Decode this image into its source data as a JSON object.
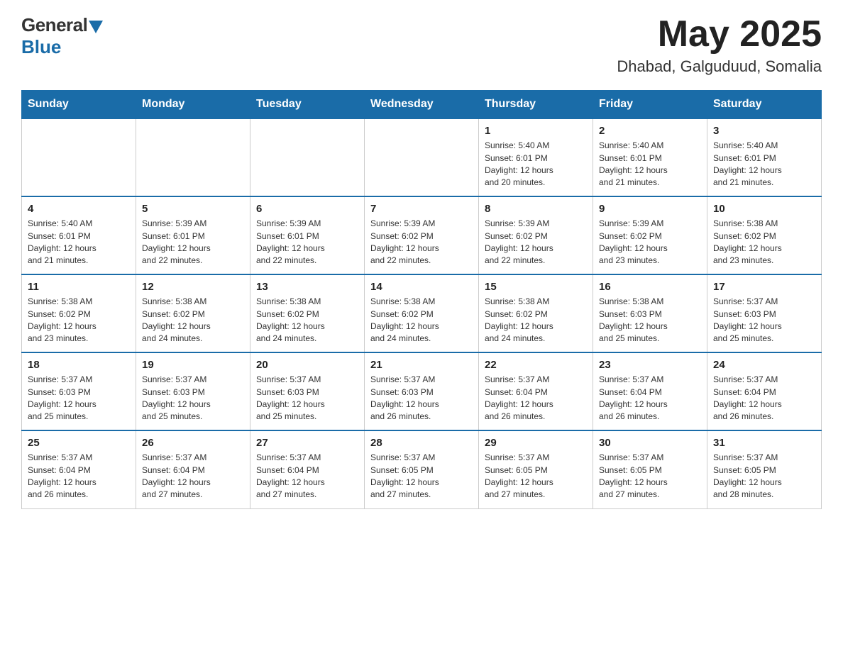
{
  "header": {
    "logo_general": "General",
    "logo_blue": "Blue",
    "month_title": "May 2025",
    "location": "Dhabad, Galguduud, Somalia"
  },
  "weekdays": [
    "Sunday",
    "Monday",
    "Tuesday",
    "Wednesday",
    "Thursday",
    "Friday",
    "Saturday"
  ],
  "weeks": [
    [
      {
        "day": "",
        "info": ""
      },
      {
        "day": "",
        "info": ""
      },
      {
        "day": "",
        "info": ""
      },
      {
        "day": "",
        "info": ""
      },
      {
        "day": "1",
        "info": "Sunrise: 5:40 AM\nSunset: 6:01 PM\nDaylight: 12 hours\nand 20 minutes."
      },
      {
        "day": "2",
        "info": "Sunrise: 5:40 AM\nSunset: 6:01 PM\nDaylight: 12 hours\nand 21 minutes."
      },
      {
        "day": "3",
        "info": "Sunrise: 5:40 AM\nSunset: 6:01 PM\nDaylight: 12 hours\nand 21 minutes."
      }
    ],
    [
      {
        "day": "4",
        "info": "Sunrise: 5:40 AM\nSunset: 6:01 PM\nDaylight: 12 hours\nand 21 minutes."
      },
      {
        "day": "5",
        "info": "Sunrise: 5:39 AM\nSunset: 6:01 PM\nDaylight: 12 hours\nand 22 minutes."
      },
      {
        "day": "6",
        "info": "Sunrise: 5:39 AM\nSunset: 6:01 PM\nDaylight: 12 hours\nand 22 minutes."
      },
      {
        "day": "7",
        "info": "Sunrise: 5:39 AM\nSunset: 6:02 PM\nDaylight: 12 hours\nand 22 minutes."
      },
      {
        "day": "8",
        "info": "Sunrise: 5:39 AM\nSunset: 6:02 PM\nDaylight: 12 hours\nand 22 minutes."
      },
      {
        "day": "9",
        "info": "Sunrise: 5:39 AM\nSunset: 6:02 PM\nDaylight: 12 hours\nand 23 minutes."
      },
      {
        "day": "10",
        "info": "Sunrise: 5:38 AM\nSunset: 6:02 PM\nDaylight: 12 hours\nand 23 minutes."
      }
    ],
    [
      {
        "day": "11",
        "info": "Sunrise: 5:38 AM\nSunset: 6:02 PM\nDaylight: 12 hours\nand 23 minutes."
      },
      {
        "day": "12",
        "info": "Sunrise: 5:38 AM\nSunset: 6:02 PM\nDaylight: 12 hours\nand 24 minutes."
      },
      {
        "day": "13",
        "info": "Sunrise: 5:38 AM\nSunset: 6:02 PM\nDaylight: 12 hours\nand 24 minutes."
      },
      {
        "day": "14",
        "info": "Sunrise: 5:38 AM\nSunset: 6:02 PM\nDaylight: 12 hours\nand 24 minutes."
      },
      {
        "day": "15",
        "info": "Sunrise: 5:38 AM\nSunset: 6:02 PM\nDaylight: 12 hours\nand 24 minutes."
      },
      {
        "day": "16",
        "info": "Sunrise: 5:38 AM\nSunset: 6:03 PM\nDaylight: 12 hours\nand 25 minutes."
      },
      {
        "day": "17",
        "info": "Sunrise: 5:37 AM\nSunset: 6:03 PM\nDaylight: 12 hours\nand 25 minutes."
      }
    ],
    [
      {
        "day": "18",
        "info": "Sunrise: 5:37 AM\nSunset: 6:03 PM\nDaylight: 12 hours\nand 25 minutes."
      },
      {
        "day": "19",
        "info": "Sunrise: 5:37 AM\nSunset: 6:03 PM\nDaylight: 12 hours\nand 25 minutes."
      },
      {
        "day": "20",
        "info": "Sunrise: 5:37 AM\nSunset: 6:03 PM\nDaylight: 12 hours\nand 25 minutes."
      },
      {
        "day": "21",
        "info": "Sunrise: 5:37 AM\nSunset: 6:03 PM\nDaylight: 12 hours\nand 26 minutes."
      },
      {
        "day": "22",
        "info": "Sunrise: 5:37 AM\nSunset: 6:04 PM\nDaylight: 12 hours\nand 26 minutes."
      },
      {
        "day": "23",
        "info": "Sunrise: 5:37 AM\nSunset: 6:04 PM\nDaylight: 12 hours\nand 26 minutes."
      },
      {
        "day": "24",
        "info": "Sunrise: 5:37 AM\nSunset: 6:04 PM\nDaylight: 12 hours\nand 26 minutes."
      }
    ],
    [
      {
        "day": "25",
        "info": "Sunrise: 5:37 AM\nSunset: 6:04 PM\nDaylight: 12 hours\nand 26 minutes."
      },
      {
        "day": "26",
        "info": "Sunrise: 5:37 AM\nSunset: 6:04 PM\nDaylight: 12 hours\nand 27 minutes."
      },
      {
        "day": "27",
        "info": "Sunrise: 5:37 AM\nSunset: 6:04 PM\nDaylight: 12 hours\nand 27 minutes."
      },
      {
        "day": "28",
        "info": "Sunrise: 5:37 AM\nSunset: 6:05 PM\nDaylight: 12 hours\nand 27 minutes."
      },
      {
        "day": "29",
        "info": "Sunrise: 5:37 AM\nSunset: 6:05 PM\nDaylight: 12 hours\nand 27 minutes."
      },
      {
        "day": "30",
        "info": "Sunrise: 5:37 AM\nSunset: 6:05 PM\nDaylight: 12 hours\nand 27 minutes."
      },
      {
        "day": "31",
        "info": "Sunrise: 5:37 AM\nSunset: 6:05 PM\nDaylight: 12 hours\nand 28 minutes."
      }
    ]
  ]
}
